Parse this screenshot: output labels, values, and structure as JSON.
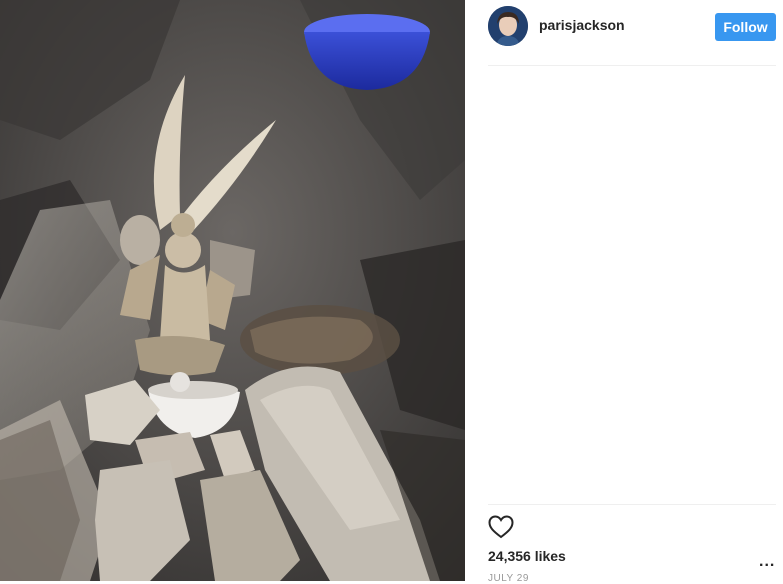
{
  "post": {
    "username": "parisjackson",
    "follow_label": "Follow",
    "likes_text": "24,356 likes",
    "more_label": "...",
    "date_text": "JULY 29",
    "icons": {
      "avatar": "avatar",
      "like": "heart-icon",
      "more": "more-options-icon"
    },
    "colors": {
      "follow_button": "#3897f0",
      "text": "#262626",
      "divider": "#efefef"
    }
  }
}
